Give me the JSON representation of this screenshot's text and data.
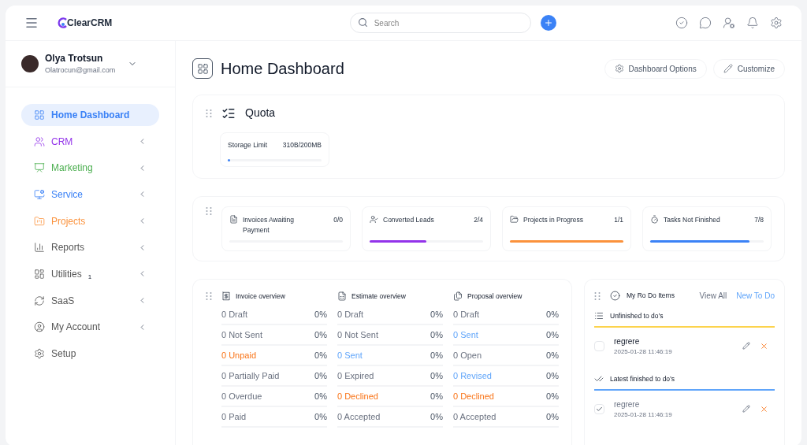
{
  "topbar": {
    "logo": "ClearCRM",
    "search": {
      "placeholder": "Search"
    }
  },
  "user": {
    "name": "Olya Trotsun",
    "email": "Olatrocun@gmail.com"
  },
  "sidebar": {
    "items": [
      {
        "label": "Home Dashboard",
        "selected": true,
        "color": "#3b82f6",
        "expandable": false
      },
      {
        "label": "CRM",
        "selected": false,
        "color": "#9333ea",
        "expandable": true
      },
      {
        "label": "Marketing",
        "selected": false,
        "color": "#4caf50",
        "expandable": true
      },
      {
        "label": "Service",
        "selected": false,
        "color": "#3b82f6",
        "expandable": true
      },
      {
        "label": "Projects",
        "selected": false,
        "color": "#fb923c",
        "expandable": true
      },
      {
        "label": "Reports",
        "selected": false,
        "color": "#555555",
        "expandable": true
      },
      {
        "label": "Utilities",
        "selected": false,
        "color": "#555555",
        "expandable": true,
        "badge": "1"
      },
      {
        "label": "SaaS",
        "selected": false,
        "color": "#555555",
        "expandable": true
      },
      {
        "label": "My Account",
        "selected": false,
        "color": "#555555",
        "expandable": true
      },
      {
        "label": "Setup",
        "selected": false,
        "color": "#555555",
        "expandable": false
      }
    ]
  },
  "page": {
    "title": "Home Dashboard",
    "actions": [
      "Dashboard Options",
      "Customize"
    ]
  },
  "quota": {
    "title": "Quota",
    "items": [
      {
        "label": "Storage Limit",
        "reading": "310B/200MB",
        "level": 0.01,
        "color": "#3b82f6"
      }
    ]
  },
  "stats": [
    {
      "label": "Invoices Awaiting Payment",
      "reading": "0/0",
      "level": 0
    },
    {
      "label": "Converted Leads",
      "reading": "2/4",
      "level": 0.5,
      "color": "#9333ea"
    },
    {
      "label": "Projects in Progress",
      "reading": "1/1",
      "level": 1,
      "color": "#fb923c"
    },
    {
      "label": "Tasks Not Finished",
      "reading": "7/8",
      "level": 0.875,
      "color": "#3b82f6"
    }
  ],
  "overviews": [
    {
      "title": "Invoice overview",
      "rows": [
        {
          "label": "0 Draft",
          "value": "0%",
          "color": "#6b7280"
        },
        {
          "label": "0 Not Sent",
          "value": "0%",
          "color": "#6b7280"
        },
        {
          "label": "0 Unpaid",
          "value": "0%",
          "color": "#f97316"
        },
        {
          "label": "0 Partially Paid",
          "value": "0%",
          "color": "#6b7280"
        },
        {
          "label": "0 Overdue",
          "value": "0%",
          "color": "#6b7280"
        },
        {
          "label": "0 Paid",
          "value": "0%",
          "color": "#6b7280"
        }
      ]
    },
    {
      "title": "Estimate overview",
      "rows": [
        {
          "label": "0 Draft",
          "value": "0%",
          "color": "#6b7280"
        },
        {
          "label": "0 Not Sent",
          "value": "0%",
          "color": "#6b7280"
        },
        {
          "label": "0 Sent",
          "value": "0%",
          "color": "#60a5fa"
        },
        {
          "label": "0 Expired",
          "value": "0%",
          "color": "#6b7280"
        },
        {
          "label": "0 Declined",
          "value": "0%",
          "color": "#f97316"
        },
        {
          "label": "0 Accepted",
          "value": "0%",
          "color": "#6b7280"
        }
      ]
    },
    {
      "title": "Proposal overview",
      "rows": [
        {
          "label": "0 Draft",
          "value": "0%",
          "color": "#6b7280"
        },
        {
          "label": "0 Sent",
          "value": "0%",
          "color": "#60a5fa"
        },
        {
          "label": "0 Open",
          "value": "0%",
          "color": "#6b7280"
        },
        {
          "label": "0 Revised",
          "value": "0%",
          "color": "#60a5fa"
        },
        {
          "label": "0 Declined",
          "value": "0%",
          "color": "#f97316"
        },
        {
          "label": "0 Accepted",
          "value": "0%",
          "color": "#6b7280"
        }
      ]
    }
  ],
  "todos": {
    "title": "My Ro Do Items",
    "view_all": "View All",
    "new": "New To Do",
    "sections": [
      {
        "title": "Unfinished to do’s",
        "color": "#fcd34d",
        "items": [
          {
            "text": "regrere",
            "date": "2025-01-28 11:46:19",
            "checked": false
          }
        ]
      },
      {
        "title": "Latest finished to do’s",
        "color": "#60a5fa",
        "items": [
          {
            "text": "regrere",
            "date": "2025-01-28 11:46:19",
            "checked": true
          }
        ]
      }
    ]
  }
}
